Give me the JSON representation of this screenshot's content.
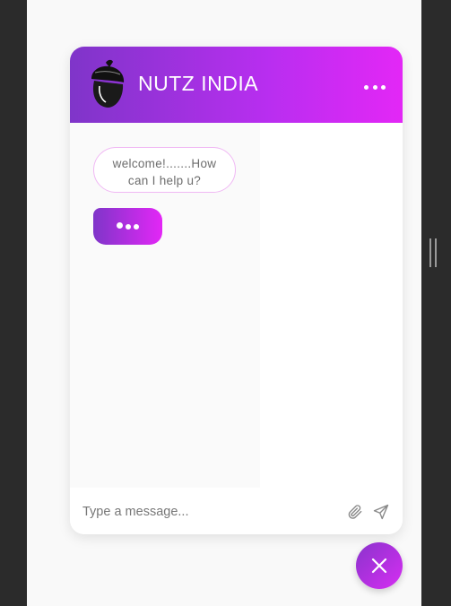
{
  "header": {
    "title": "NUTZ INDIA",
    "logo_icon": "acorn-icon",
    "menu_icon": "more-horizontal-icon"
  },
  "messages": [
    {
      "from": "bot",
      "text": "welcome!.......How can I help u?"
    }
  ],
  "typing_indicator": {
    "icon": "typing-dots-icon"
  },
  "composer": {
    "placeholder": "Type a message...",
    "attach_icon": "paperclip-icon",
    "send_icon": "send-icon"
  },
  "launcher": {
    "icon": "close-icon"
  },
  "colors": {
    "gradient_start": "#7f35c9",
    "gradient_end": "#e327f6",
    "bubble_border": "#f0b8f4"
  }
}
